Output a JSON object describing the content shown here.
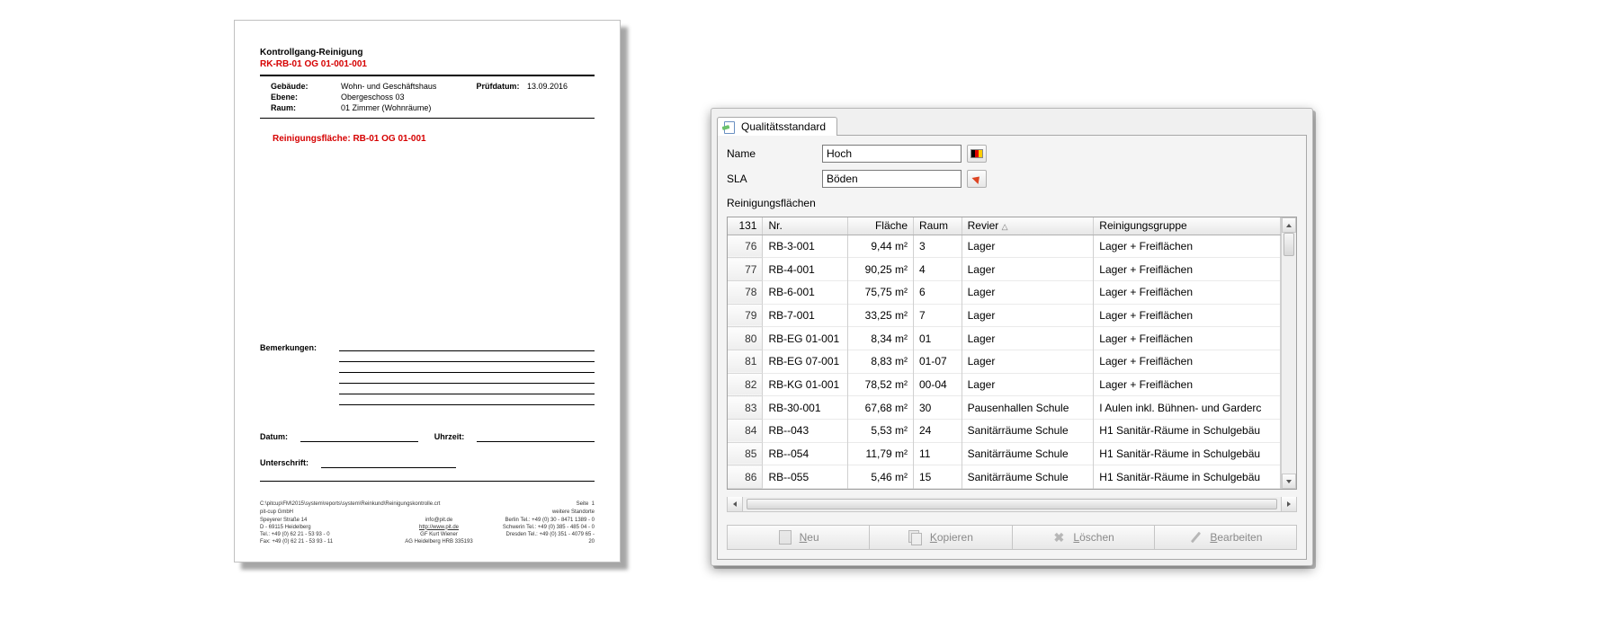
{
  "document": {
    "title": "Kontrollgang-Reinigung",
    "code": "RK-RB-01 OG 01-001-001",
    "meta": {
      "building_label": "Gebäude:",
      "building_value": "Wohn- und Geschäftshaus",
      "floor_label": "Ebene:",
      "floor_value": "Obergeschoss 03",
      "room_label": "Raum:",
      "room_value": "01 Zimmer (Wohnräume)",
      "pruef_label": "Prüfdatum:",
      "pruef_value": "13.09.2016"
    },
    "area_line": "Reinigungsfläche: RB-01 OG 01-001",
    "remarks_label": "Bemerkungen:",
    "sign": {
      "date_label": "Datum:",
      "time_label": "Uhrzeit:",
      "sign_label": "Unterschrift:"
    },
    "footer": {
      "path": "C:\\pitcup\\FM\\2015\\system\\reports\\system\\Reinkund\\Reinigungskontrolle.crt",
      "page_label": "Seite",
      "page_no": "1",
      "company": "pit-cup GmbH",
      "more_sites": "weitere Standorte",
      "addr1": "Speyerer Straße 14",
      "addr2": "D - 69115 Heidelberg",
      "tel": "Tel.: +49 (0) 62 21 - 53 93 - 0",
      "fax": "Fax: +49 (0) 62 21 - 53 93 - 11",
      "email": "info@pit.de",
      "url": "http://www.pit.de",
      "gf": "GF Kurt Wiener",
      "reg": "AG Heidelberg HRB 335193",
      "berlin": "Berlin Tel.: +49 (0) 30 - 8471 1389 - 0",
      "schwerin": "Schwerin Tel.: +49 (0) 385 - 485 04 - 0",
      "dresden": "Dresden Tel.: +49 (0) 351 - 4079 65 - 20"
    }
  },
  "dialog": {
    "tab_label": "Qualitätsstandard",
    "name_label": "Name",
    "name_value": "Hoch",
    "sla_label": "SLA",
    "sla_value": "Böden",
    "section_label": "Reinigungsflächen",
    "total_count": "131",
    "columns": {
      "nr": "Nr.",
      "flaeche": "Fläche",
      "raum": "Raum",
      "revier": "Revier",
      "gruppe": "Reinigungsgruppe"
    },
    "rows": [
      {
        "idx": "76",
        "nr": "RB-3-001",
        "fl": "9,44 m²",
        "raum": "3",
        "revier": "Lager",
        "gruppe": "Lager + Freiflächen"
      },
      {
        "idx": "77",
        "nr": "RB-4-001",
        "fl": "90,25 m²",
        "raum": "4",
        "revier": "Lager",
        "gruppe": "Lager + Freiflächen"
      },
      {
        "idx": "78",
        "nr": "RB-6-001",
        "fl": "75,75 m²",
        "raum": "6",
        "revier": "Lager",
        "gruppe": "Lager + Freiflächen"
      },
      {
        "idx": "79",
        "nr": "RB-7-001",
        "fl": "33,25 m²",
        "raum": "7",
        "revier": "Lager",
        "gruppe": "Lager + Freiflächen"
      },
      {
        "idx": "80",
        "nr": "RB-EG 01-001",
        "fl": "8,34 m²",
        "raum": "01",
        "revier": "Lager",
        "gruppe": "Lager + Freiflächen"
      },
      {
        "idx": "81",
        "nr": "RB-EG 07-001",
        "fl": "8,83 m²",
        "raum": "01-07",
        "revier": "Lager",
        "gruppe": "Lager + Freiflächen"
      },
      {
        "idx": "82",
        "nr": "RB-KG 01-001",
        "fl": "78,52 m²",
        "raum": "00-04",
        "revier": "Lager",
        "gruppe": "Lager + Freiflächen"
      },
      {
        "idx": "83",
        "nr": "RB-30-001",
        "fl": "67,68 m²",
        "raum": "30",
        "revier": "Pausenhallen Schule",
        "gruppe": "I Aulen inkl. Bühnen- und Garderc"
      },
      {
        "idx": "84",
        "nr": "RB--043",
        "fl": "5,53 m²",
        "raum": "24",
        "revier": "Sanitärräume Schule",
        "gruppe": "H1 Sanitär-Räume in Schulgebäu"
      },
      {
        "idx": "85",
        "nr": "RB--054",
        "fl": "11,79 m²",
        "raum": "11",
        "revier": "Sanitärräume Schule",
        "gruppe": "H1 Sanitär-Räume in Schulgebäu"
      },
      {
        "idx": "86",
        "nr": "RB--055",
        "fl": "5,46 m²",
        "raum": "15",
        "revier": "Sanitärräume Schule",
        "gruppe": "H1 Sanitär-Räume in Schulgebäu"
      }
    ],
    "buttons": {
      "neu": "Neu",
      "kopieren": "Kopieren",
      "loeschen": "Löschen",
      "bearbeiten": "Bearbeiten"
    }
  }
}
